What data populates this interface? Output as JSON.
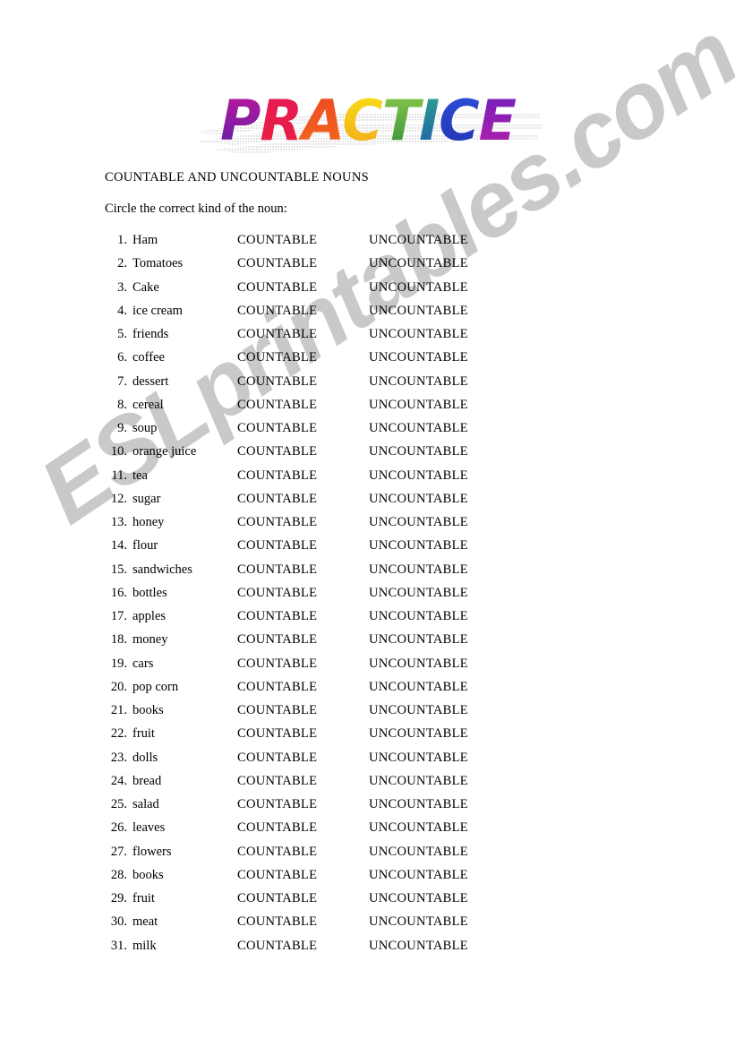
{
  "page": {
    "background_color": "#ffffff",
    "watermark_text": "ESLprintables.com",
    "watermark_color": "#c9c9c9"
  },
  "title": {
    "text": "PRACTICE",
    "letters": [
      {
        "char": "P",
        "color_top": "#c2179b",
        "color_bottom": "#5a1fa8"
      },
      {
        "char": "R",
        "color_top": "#e8185a",
        "color_bottom": "#e81f3c"
      },
      {
        "char": "A",
        "color_top": "#ef4623",
        "color_bottom": "#f06a1e"
      },
      {
        "char": "C",
        "color_top": "#f7d417",
        "color_bottom": "#f2b01a"
      },
      {
        "char": "T",
        "color_top": "#7cc242",
        "color_bottom": "#3f9c3a"
      },
      {
        "char": "I",
        "color_top": "#2fa38f",
        "color_bottom": "#1f6fa8"
      },
      {
        "char": "C",
        "color_top": "#2a44c8",
        "color_bottom": "#1f3bb5"
      },
      {
        "char": "E",
        "color_top": "#7a1fb8",
        "color_bottom": "#a81fa8"
      }
    ],
    "shadow_color": "#c4c4c4"
  },
  "heading": "COUNTABLE AND UNCOUNTABLE NOUNS",
  "instruction": "Circle the correct kind of the noun:",
  "columns": {
    "countable_label": "COUNTABLE",
    "uncountable_label": "UNCOUNTABLE"
  },
  "items": [
    {
      "num": "1.",
      "word": "Ham",
      "countable": "COUNTABLE",
      "uncountable": "UNCOUNTABLE"
    },
    {
      "num": "2.",
      "word": "Tomatoes",
      "countable": "COUNTABLE",
      "uncountable": "UNCOUNTABLE"
    },
    {
      "num": "3.",
      "word": "Cake",
      "countable": "COUNTABLE",
      "uncountable": "UNCOUNTABLE"
    },
    {
      "num": "4.",
      "word": "ice cream",
      "countable": "COUNTABLE",
      "uncountable": "UNCOUNTABLE"
    },
    {
      "num": "5.",
      "word": "friends",
      "countable": "COUNTABLE",
      "uncountable": "UNCOUNTABLE"
    },
    {
      "num": "6.",
      "word": "coffee",
      "countable": "COUNTABLE",
      "uncountable": "UNCOUNTABLE"
    },
    {
      "num": "7.",
      "word": "dessert",
      "countable": "COUNTABLE",
      "uncountable": "UNCOUNTABLE"
    },
    {
      "num": "8.",
      "word": "cereal",
      "countable": "COUNTABLE",
      "uncountable": "UNCOUNTABLE"
    },
    {
      "num": "9.",
      "word": "soup",
      "countable": "COUNTABLE",
      "uncountable": "UNCOUNTABLE"
    },
    {
      "num": "10.",
      "word": "orange juice",
      "countable": "COUNTABLE",
      "uncountable": "UNCOUNTABLE"
    },
    {
      "num": "11.",
      "word": "tea",
      "countable": "COUNTABLE",
      "uncountable": "UNCOUNTABLE"
    },
    {
      "num": "12.",
      "word": "sugar",
      "countable": "COUNTABLE",
      "uncountable": "UNCOUNTABLE"
    },
    {
      "num": "13.",
      "word": "honey",
      "countable": "COUNTABLE",
      "uncountable": "UNCOUNTABLE"
    },
    {
      "num": "14.",
      "word": "flour",
      "countable": "COUNTABLE",
      "uncountable": "UNCOUNTABLE"
    },
    {
      "num": "15.",
      "word": "sandwiches",
      "countable": "COUNTABLE",
      "uncountable": "UNCOUNTABLE"
    },
    {
      "num": "16.",
      "word": "bottles",
      "countable": "COUNTABLE",
      "uncountable": "UNCOUNTABLE"
    },
    {
      "num": "17.",
      "word": "apples",
      "countable": "COUNTABLE",
      "uncountable": "UNCOUNTABLE"
    },
    {
      "num": "18.",
      "word": "money",
      "countable": "COUNTABLE",
      "uncountable": "UNCOUNTABLE"
    },
    {
      "num": "19.",
      "word": "cars",
      "countable": "COUNTABLE",
      "uncountable": "UNCOUNTABLE"
    },
    {
      "num": "20.",
      "word": "pop corn",
      "countable": "COUNTABLE",
      "uncountable": "UNCOUNTABLE"
    },
    {
      "num": "21.",
      "word": "books",
      "countable": "COUNTABLE",
      "uncountable": "UNCOUNTABLE"
    },
    {
      "num": "22.",
      "word": "fruit",
      "countable": "COUNTABLE",
      "uncountable": "UNCOUNTABLE"
    },
    {
      "num": "23.",
      "word": "dolls",
      "countable": "COUNTABLE",
      "uncountable": "UNCOUNTABLE"
    },
    {
      "num": "24.",
      "word": "bread",
      "countable": "COUNTABLE",
      "uncountable": "UNCOUNTABLE"
    },
    {
      "num": "25.",
      "word": "salad",
      "countable": "COUNTABLE",
      "uncountable": "UNCOUNTABLE"
    },
    {
      "num": "26.",
      "word": "leaves",
      "countable": "COUNTABLE",
      "uncountable": "UNCOUNTABLE"
    },
    {
      "num": "27.",
      "word": "flowers",
      "countable": "COUNTABLE",
      "uncountable": "UNCOUNTABLE"
    },
    {
      "num": "28.",
      "word": "books",
      "countable": "COUNTABLE",
      "uncountable": "UNCOUNTABLE"
    },
    {
      "num": "29.",
      "word": "fruit",
      "countable": "COUNTABLE",
      "uncountable": "UNCOUNTABLE"
    },
    {
      "num": "30.",
      "word": "meat",
      "countable": "COUNTABLE",
      "uncountable": "UNCOUNTABLE"
    },
    {
      "num": "31.",
      "word": "milk",
      "countable": "COUNTABLE",
      "uncountable": "UNCOUNTABLE"
    }
  ]
}
